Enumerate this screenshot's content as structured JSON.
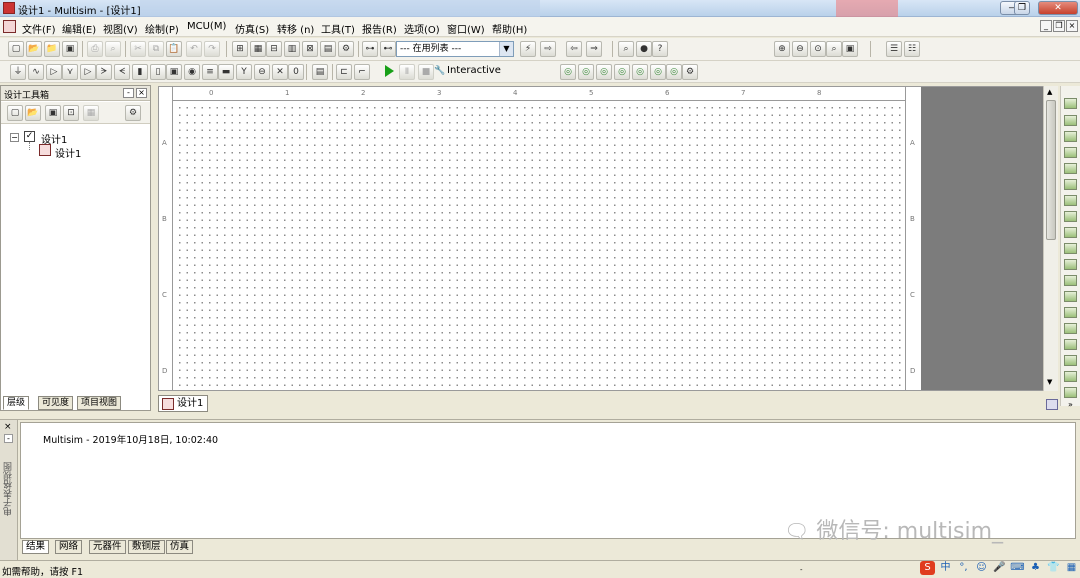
{
  "window": {
    "title": "设计1 - Multisim - [设计1]",
    "buttons": [
      "—",
      "❐",
      "✕"
    ],
    "mdi_buttons": [
      "_",
      "❐",
      "×"
    ]
  },
  "menu": [
    {
      "label": "文件(F)"
    },
    {
      "label": "编辑(E)"
    },
    {
      "label": "视图(V)"
    },
    {
      "label": "绘制(P)"
    },
    {
      "label": "MCU(M)"
    },
    {
      "label": "仿真(S)"
    },
    {
      "label": "转移 (n)"
    },
    {
      "label": "工具(T)"
    },
    {
      "label": "报告(R)"
    },
    {
      "label": "选项(O)"
    },
    {
      "label": "窗口(W)"
    },
    {
      "label": "帮助(H)"
    }
  ],
  "toolbar": {
    "in_use_list": "--- 在用列表 ---",
    "interactive_label": "Interactive"
  },
  "design_toolbox": {
    "title": "设计工具箱",
    "header_buttons": [
      "-",
      "×"
    ],
    "tree": {
      "root": "设计1",
      "child": "设计1"
    },
    "tabs": [
      "层级",
      "可见度",
      "项目视图"
    ]
  },
  "canvas": {
    "tab_label": "设计1",
    "ruler_top": [
      "0",
      "1",
      "2",
      "3",
      "4",
      "5",
      "6",
      "7",
      "8"
    ],
    "ruler_left": [
      "A",
      "B",
      "C",
      "D"
    ]
  },
  "output": {
    "side_label": "电子表格视图",
    "message": "Multisim  -  2019年10月18日, 10:02:40",
    "tabs": [
      "结果",
      "网络",
      "元器件",
      "敷铜层",
      "仿真"
    ]
  },
  "watermark": "微信号: multisim_",
  "statusbar": {
    "text": "如需帮助，请按 F1",
    "ime": [
      "S",
      "中",
      "°,",
      "☺",
      "🎤",
      "⌨",
      "♣",
      "👕",
      "▦"
    ]
  },
  "colors": {
    "title_bg": "#c9dcf0",
    "sim_run": "#18a018",
    "canvas_border": "#7c7c7c"
  }
}
